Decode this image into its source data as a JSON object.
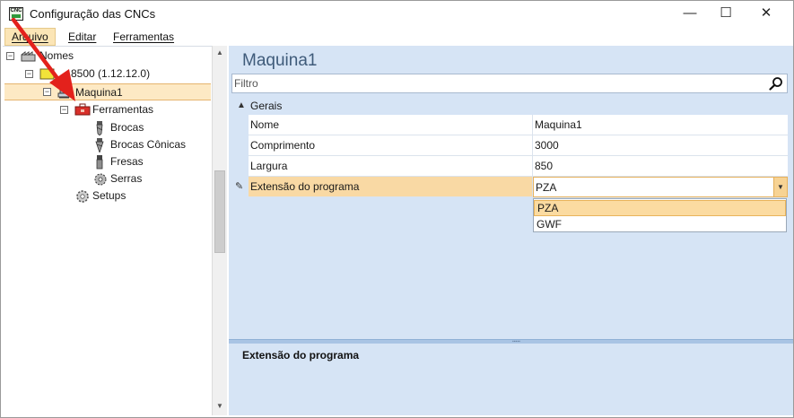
{
  "window": {
    "title": "Configuração das CNCs",
    "app_icon_text": "CNC",
    "controls": {
      "minimize": "—",
      "maximize": "☐",
      "close": "✕"
    }
  },
  "menu": {
    "items": [
      "Arquivo",
      "Editar",
      "Ferramentas"
    ]
  },
  "tree": {
    "items": [
      {
        "label": "Nomes",
        "icon": "factory-icon",
        "expander": "⊟"
      },
      {
        "label": "8500 (1.12.12.0)",
        "icon": "machine-group-icon",
        "expander": "⊟"
      },
      {
        "label": "Maquina1",
        "icon": "machine-icon",
        "expander": "⊟",
        "selected": true
      },
      {
        "label": "Ferramentas",
        "icon": "toolbox-icon",
        "expander": "⊟"
      },
      {
        "label": "Brocas",
        "icon": "drill-bit-icon"
      },
      {
        "label": "Brocas Cônicas",
        "icon": "conical-drill-icon"
      },
      {
        "label": "Fresas",
        "icon": "mill-icon"
      },
      {
        "label": "Serras",
        "icon": "saw-blade-icon"
      },
      {
        "label": "Setups",
        "icon": "gear-icon"
      }
    ]
  },
  "properties": {
    "heading": "Maquina1",
    "filter_placeholder": "Filtro",
    "category": "Gerais",
    "rows": [
      {
        "name": "Nome",
        "value": "Maquina1"
      },
      {
        "name": "Comprimento",
        "value": "3000"
      },
      {
        "name": "Largura",
        "value": "850"
      },
      {
        "name": "Extensão do programa",
        "value": "PZA"
      }
    ],
    "dropdown_options": [
      "PZA",
      "GWF"
    ],
    "description_title": "Extensão do programa"
  },
  "colors": {
    "panel_bg": "#d6e4f5",
    "selection": "#fde9c4",
    "heading": "#3f5b7a",
    "annotation_arrow": "#e3211c"
  }
}
